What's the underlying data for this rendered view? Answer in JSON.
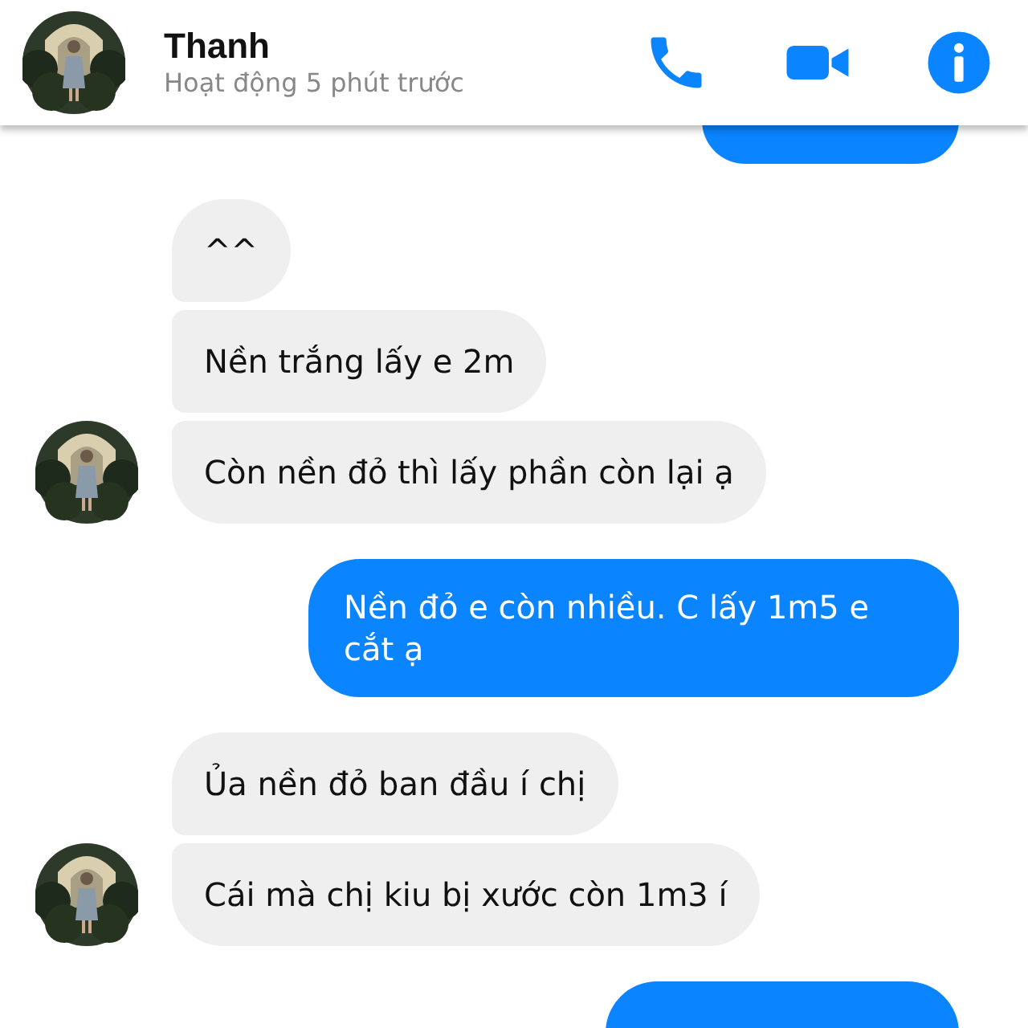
{
  "header": {
    "name": "Thanh",
    "status": "Hoạt động 5 phút trước"
  },
  "messages": [
    {
      "kind": "sent"
    },
    {
      "kind": "received",
      "text": "^^",
      "avatar": false
    },
    {
      "kind": "received",
      "text": "Nền trắng lấy e 2m",
      "avatar": false
    },
    {
      "kind": "received",
      "text": "Còn nền đỏ thì lấy phần còn lại ạ",
      "avatar": true
    },
    {
      "kind": "sent",
      "text": "Nền đỏ e còn nhiều. C lấy 1m5 e cắt ạ"
    },
    {
      "kind": "received",
      "text": "Ủa nền đỏ ban đầu í chị",
      "avatar": false
    },
    {
      "kind": "received",
      "text": "Cái mà chị kiu bị xước còn 1m3 í",
      "avatar": true
    },
    {
      "kind": "sent"
    }
  ]
}
